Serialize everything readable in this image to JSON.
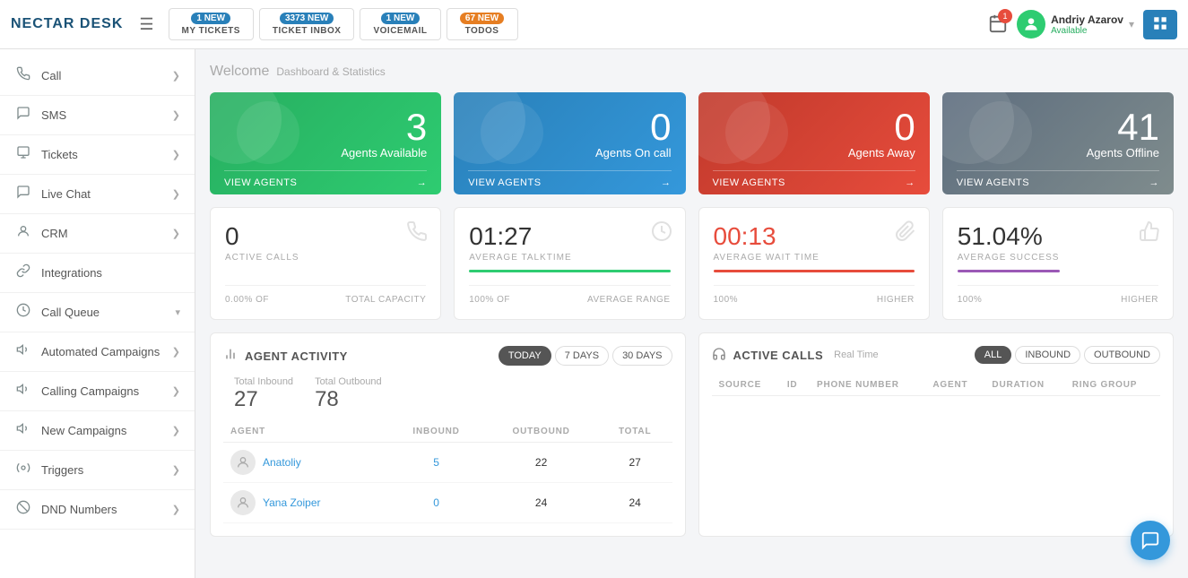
{
  "header": {
    "logo": "NECTAR DESK",
    "hamburger_icon": "☰",
    "tabs": [
      {
        "badge": "1 NEW",
        "badge_color": "blue",
        "label": "MY TICKETS"
      },
      {
        "badge": "3373 NEW",
        "badge_color": "blue",
        "label": "TICKET INBOX"
      },
      {
        "badge": "1 NEW",
        "badge_color": "blue",
        "label": "VOICEMAIL"
      },
      {
        "badge": "67 NEW",
        "badge_color": "orange",
        "label": "TODOS"
      }
    ],
    "calendar_icon": "📅",
    "notif_count": "1",
    "user_name": "Andriy Azarov",
    "user_status": "Available",
    "grid_icon": "⊞"
  },
  "sidebar": {
    "items": [
      {
        "icon": "📞",
        "label": "Call",
        "arrow": "❯"
      },
      {
        "icon": "💬",
        "label": "SMS",
        "arrow": "❯"
      },
      {
        "icon": "✉",
        "label": "Tickets",
        "arrow": "❯"
      },
      {
        "icon": "💭",
        "label": "Live Chat",
        "arrow": "❯"
      },
      {
        "icon": "👤",
        "label": "CRM",
        "arrow": "❯"
      },
      {
        "icon": "🔗",
        "label": "Integrations",
        "arrow": ""
      },
      {
        "icon": "⏳",
        "label": "Call Queue",
        "arrow": "▾"
      },
      {
        "icon": "📢",
        "label": "Automated Campaigns",
        "arrow": "❯"
      },
      {
        "icon": "📢",
        "label": "Calling Campaigns",
        "arrow": "❯"
      },
      {
        "icon": "📢",
        "label": "New Campaigns",
        "arrow": "❯"
      },
      {
        "icon": "⚙",
        "label": "Triggers",
        "arrow": "❯"
      },
      {
        "icon": "⚙",
        "label": "DND Numbers",
        "arrow": "❯"
      }
    ]
  },
  "welcome": {
    "text": "Welcome",
    "sub": "Dashboard & Statistics"
  },
  "stat_cards": [
    {
      "num": "3",
      "label": "Agents Available",
      "view": "VIEW AGENTS",
      "color": "green"
    },
    {
      "num": "0",
      "label": "Agents On call",
      "view": "VIEW AGENTS",
      "color": "blue"
    },
    {
      "num": "0",
      "label": "Agents Away",
      "view": "VIEW AGENTS",
      "color": "red"
    },
    {
      "num": "41",
      "label": "Agents Offline",
      "view": "VIEW AGENTS",
      "color": "dark"
    }
  ],
  "metric_cards": [
    {
      "val": "0",
      "label": "ACTIVE CALLS",
      "icon": "📞",
      "footer_left": "0.00% OF",
      "footer_right": "TOTAL CAPACITY",
      "bar_color": "green",
      "bar_width": "0%"
    },
    {
      "val": "01:27",
      "label": "AVERAGE TALKTIME",
      "icon": "🕐",
      "footer_left": "100% OF",
      "footer_right": "AVERAGE RANGE",
      "bar_color": "green",
      "bar_width": "100%"
    },
    {
      "val": "00:13",
      "label": "AVERAGE WAIT TIME",
      "icon": "📎",
      "footer_left": "100%",
      "footer_right": "HIGHER",
      "bar_color": "red",
      "bar_width": "100%"
    },
    {
      "val": "51.04%",
      "label": "AVERAGE SUCCESS",
      "icon": "👍",
      "footer_left": "100%",
      "footer_right": "HIGHER",
      "bar_color": "purple",
      "bar_width": "51%"
    }
  ],
  "agent_activity": {
    "title": "AGENT ACTIVITY",
    "icon": "📊",
    "tabs": [
      "TODAY",
      "7 DAYS",
      "30 DAYS"
    ],
    "active_tab": 0,
    "total_inbound_label": "Total Inbound",
    "total_inbound_val": "27",
    "total_outbound_label": "Total Outbound",
    "total_outbound_val": "78",
    "columns": [
      "AGENT",
      "INBOUND",
      "OUTBOUND",
      "TOTAL"
    ],
    "rows": [
      {
        "name": "Anatoliy",
        "inbound": "5",
        "outbound": "22",
        "total": "27"
      },
      {
        "name": "Yana Zoiper",
        "inbound": "0",
        "outbound": "24",
        "total": "24"
      }
    ]
  },
  "active_calls": {
    "title": "ACTIVE CALLS",
    "subtitle": "Real Time",
    "icon": "🎧",
    "filters": [
      "ALL",
      "INBOUND",
      "OUTBOUND"
    ],
    "active_filter": 0,
    "columns": [
      "SOURCE",
      "ID",
      "PHONE NUMBER",
      "AGENT",
      "DURATION",
      "RING GROUP"
    ]
  },
  "chat_fab": "💬"
}
